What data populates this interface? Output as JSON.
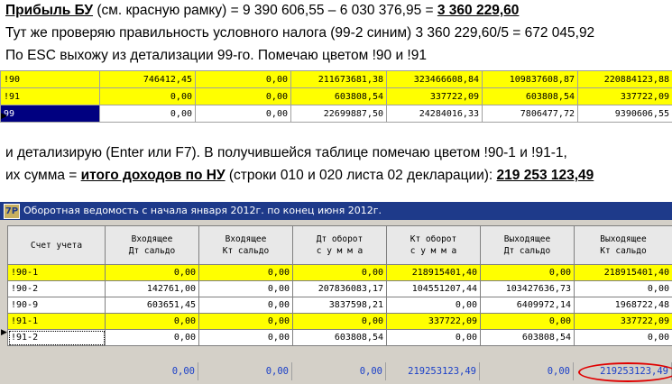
{
  "text": {
    "line1": {
      "bold_label": "Прибыль БУ",
      "rest": " (см. красную рамку) = 9 390 606,55 – 6 030 376,95 = ",
      "result": "3 360 229,60"
    },
    "line2": "Тут же проверяю правильность  условного налога (99-2 синим)  3 360 229,60/5 = 672 045,92",
    "line3": "По ESC выхожу из детализации 99-го. Помечаю цветом !90 и !91",
    "line4": "и детализирую (Enter или F7). В получившейся таблице помечаю цветом !90-1 и !91-1,",
    "line5": {
      "prefix": "их сумма = ",
      "bold_label": "итого доходов по НУ",
      "middle": " (строки 010 и 020 листа 02 декларации): ",
      "result": "219 253 123,49"
    }
  },
  "top_table": {
    "rows": [
      {
        "name": "!90",
        "cells": [
          "746412,45",
          "0,00",
          "211673681,38",
          "323466608,84",
          "109837608,87",
          "220884123,88"
        ],
        "highlight": "yellow"
      },
      {
        "name": "!91",
        "cells": [
          "0,00",
          "0,00",
          "603808,54",
          "337722,09",
          "603808,54",
          "337722,09"
        ],
        "highlight": "yellow"
      },
      {
        "name": "99",
        "cells": [
          "0,00",
          "0,00",
          "22699887,50",
          "24284016,33",
          "7806477,72",
          "9390606,55"
        ],
        "highlight": "none",
        "selected": true
      }
    ]
  },
  "window": {
    "title": "Оборотная ведомость с начала января 2012г. по конец июня 2012г.",
    "icon_label": "7P",
    "headers": [
      "Счет учета",
      "Входящее\nДт сальдо",
      "Входящее\nКт сальдо",
      "Дт оборот\nс у м м а",
      "Кт оборот\nс у м м а",
      "Выходящее\nДт сальдо",
      "Выходящее\nКт сальдо"
    ],
    "rows": [
      {
        "name": "!90-1",
        "cells": [
          "0,00",
          "0,00",
          "0,00",
          "218915401,40",
          "0,00",
          "218915401,40"
        ],
        "highlight": "yellow"
      },
      {
        "name": "!90-2",
        "cells": [
          "142761,00",
          "0,00",
          "207836083,17",
          "104551207,44",
          "103427636,73",
          "0,00"
        ],
        "highlight": "none"
      },
      {
        "name": "!90-9",
        "cells": [
          "603651,45",
          "0,00",
          "3837598,21",
          "0,00",
          "6409972,14",
          "1968722,48"
        ],
        "highlight": "none"
      },
      {
        "name": "!91-1",
        "cells": [
          "0,00",
          "0,00",
          "0,00",
          "337722,09",
          "0,00",
          "337722,09"
        ],
        "highlight": "yellow"
      },
      {
        "name": "!91-2",
        "cells": [
          "0,00",
          "0,00",
          "603808,54",
          "0,00",
          "603808,54",
          "0,00"
        ],
        "highlight": "none",
        "selected": true
      }
    ],
    "footer": [
      "0,00",
      "0,00",
      "0,00",
      "219253123,49",
      "0,00",
      "219253123,49"
    ]
  }
}
